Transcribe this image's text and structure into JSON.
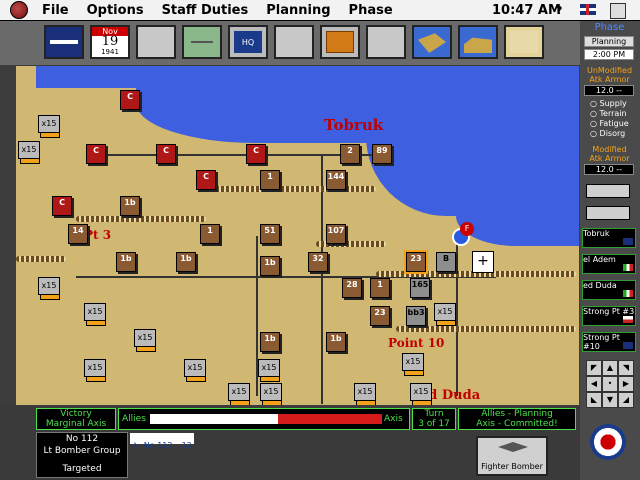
{
  "menubar": {
    "items": [
      "File",
      "Options",
      "Staff Duties",
      "Planning",
      "Phase"
    ],
    "clock": "10:47 AM",
    "help": "?"
  },
  "toolbar": {
    "date_month": "Nov",
    "date_day": "19",
    "date_year": "1941",
    "hq_label": "HQ"
  },
  "map": {
    "towns": {
      "tobruk": "Tobruk",
      "point10": "Point 10",
      "point3": "Pt 3",
      "ed_duda": "ed Duda"
    },
    "units": [
      {
        "t": "red",
        "l": "C"
      },
      {
        "t": "red",
        "l": "C"
      },
      {
        "t": "red",
        "l": "C"
      },
      {
        "t": "red",
        "l": "C"
      },
      {
        "t": "red",
        "l": "C"
      },
      {
        "t": "red",
        "l": "C"
      },
      {
        "t": "brown",
        "l": "2"
      },
      {
        "t": "brown",
        "l": "89"
      },
      {
        "t": "brown",
        "l": "144"
      },
      {
        "t": "brown",
        "l": "1"
      },
      {
        "t": "brown",
        "l": "1b"
      },
      {
        "t": "brown",
        "l": "14"
      },
      {
        "t": "brown",
        "l": "1"
      },
      {
        "t": "brown",
        "l": "51"
      },
      {
        "t": "brown",
        "l": "107"
      },
      {
        "t": "brown",
        "l": "1b"
      },
      {
        "t": "brown",
        "l": "32"
      },
      {
        "t": "brown",
        "l": "1b"
      },
      {
        "t": "brown",
        "l": "1b"
      },
      {
        "t": "brown",
        "l": "23"
      },
      {
        "t": "brown",
        "l": "28"
      },
      {
        "t": "brown",
        "l": "1"
      },
      {
        "t": "grey",
        "l": "165"
      },
      {
        "t": "grey",
        "l": "B"
      },
      {
        "t": "grey",
        "l": "bb3"
      },
      {
        "t": "brown",
        "l": "23"
      },
      {
        "t": "brown",
        "l": "1b"
      },
      {
        "t": "brown",
        "l": "1b"
      }
    ],
    "stacks": [
      "x15",
      "x15",
      "x15",
      "x15",
      "x15",
      "x15",
      "x15",
      "x15",
      "x15",
      "x15",
      "x15",
      "x15",
      "x15",
      "x15"
    ]
  },
  "right": {
    "phase": "Phase",
    "planning": "Planning",
    "time": "2:00 PM",
    "unmod": "UnModified",
    "atkarmor": "Atk  Armor",
    "val1": "12.0  --",
    "checks": [
      "Supply",
      "Terrain",
      "Fatigue",
      "Disorg"
    ],
    "mod": "Modified",
    "atkarmor2": "Atk  Armor",
    "val2": "12.0  --",
    "cards": [
      {
        "name": "Tobruk"
      },
      {
        "name": "el Adem"
      },
      {
        "name": "ed Duda"
      },
      {
        "name": "Strong Pt #3"
      },
      {
        "name": "Strong Pt #10"
      }
    ]
  },
  "bottom": {
    "victory": "Victory",
    "victory_level": "Marginal Axis",
    "allies": "Allies",
    "axis": "Axis",
    "turn": "Turn",
    "turn_of": "3 of 17",
    "status1": "Allies - Planning",
    "status2": "Axis - Committed!",
    "unit_no": "No 112",
    "unit_type": "Lt Bomber Group",
    "targeted": "Targeted",
    "list_item": "No 112",
    "list_num": "12",
    "fighter": "Fighter Bomber",
    "balance_allies": 0.55
  }
}
